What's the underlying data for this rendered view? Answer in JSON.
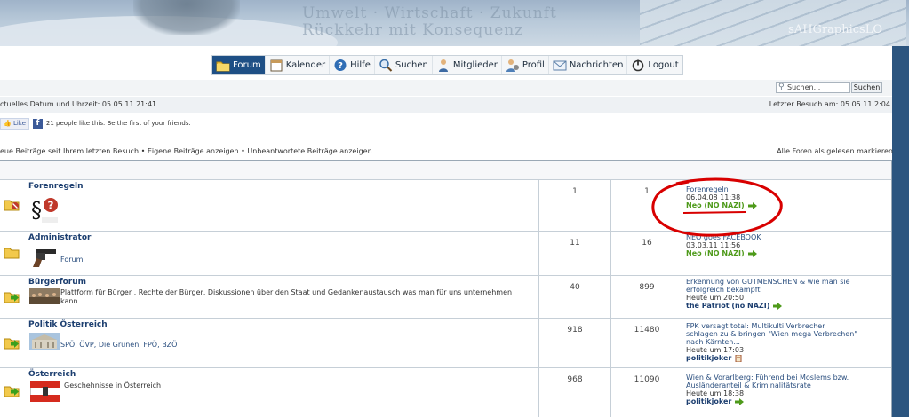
{
  "banner": {
    "ghost_line1": "Rückkehr mit Konsequenz",
    "ghost_line2": "Umwelt · Wirtschaft · Zukunft",
    "logo": "sAHGraphicsLO"
  },
  "nav": {
    "items": [
      {
        "label": "Forum",
        "icon": "folder-icon"
      },
      {
        "label": "Kalender",
        "icon": "calendar-icon"
      },
      {
        "label": "Hilfe",
        "icon": "help-icon"
      },
      {
        "label": "Suchen",
        "icon": "search-icon"
      },
      {
        "label": "Mitglieder",
        "icon": "members-icon"
      },
      {
        "label": "Profil",
        "icon": "profile-icon"
      },
      {
        "label": "Nachrichten",
        "icon": "envelope-icon"
      },
      {
        "label": "Logout",
        "icon": "power-icon"
      }
    ]
  },
  "search": {
    "placeholder": "Suchen...",
    "button": "Suchen"
  },
  "dateline": {
    "left": "ctuelles Datum und Uhrzeit: 05.05.11 21:41",
    "right": "Letzter Besuch am: 05.05.11 2:04"
  },
  "facebook": {
    "like": "Like",
    "text": "21 people like this. Be the first of your friends."
  },
  "links": {
    "left": "eue Beiträge seit Ihrem letzten Besuch • Eigene Beiträge anzeigen • Unbeantwortete Beiträge anzeigen",
    "right": "Alle Foren als gelesen markieren"
  },
  "forums": [
    {
      "title": "Forenregeln",
      "desc": "",
      "topics": "1",
      "posts": "1",
      "last_title": "Forenregeln",
      "last_date": "06.04.08 11:38",
      "last_user": "Neo (NO NAZI)"
    },
    {
      "title": "Administrator",
      "desc": "Forum",
      "topics": "11",
      "posts": "16",
      "last_title": "NEO goes FACEBOOK",
      "last_date": "03.03.11 11:56",
      "last_user": "Neo (NO NAZI)"
    },
    {
      "title": "Bürgerforum",
      "desc_line1": "Plattform für Bürger , Rechte der Bürger, Diskussionen über den Staat und Gedankenaustausch was man für uns unternehmen",
      "desc_line2": "kann",
      "topics": "40",
      "posts": "899",
      "last_title_line1": "Erkennung von GUTMENSCHEN & wie man sie",
      "last_title_line2": "erfolgreich bekämpft",
      "last_date": "Heute um 20:50",
      "last_user": "the Patriot (no NAZI)"
    },
    {
      "title": "Politik Österreich",
      "desc": "SPÖ, ÖVP, Die Grünen, FPÖ, BZÖ",
      "topics": "918",
      "posts": "11480",
      "last_title_line1": "FPK versagt total: Multikulti Verbrecher",
      "last_title_line2": "schlagen zu & bringen \"Wien mega Verbrechen\"",
      "last_title_line3": "nach Kärnten...",
      "last_date": "Heute um 17:03",
      "last_user": "politikjoker"
    },
    {
      "title": "Österreich",
      "desc": "Geschehnisse in Österreich",
      "topics": "968",
      "posts": "11090",
      "last_title_line1": "Wien & Vorarlberg: Führend bei Moslems bzw.",
      "last_title_line2": "Ausländeranteil & Kriminalitätsrate",
      "last_date": "Heute um 18:38",
      "last_user": "politikjoker"
    }
  ],
  "colors": {
    "accent": "#1e4f85",
    "user_green": "#4e9a1a",
    "annotation": "#d80000"
  }
}
